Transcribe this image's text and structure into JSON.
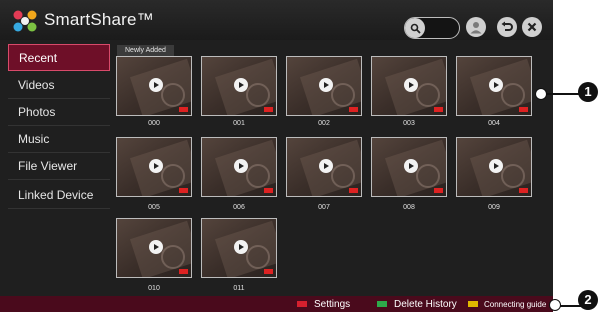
{
  "header": {
    "title": "SmartShare™",
    "icons": {
      "logo": "smartshare-logo",
      "search": "search-icon",
      "user": "user-icon",
      "back": "back-icon",
      "close": "close-icon"
    }
  },
  "sidebar": {
    "items": [
      {
        "label": "Recent",
        "selected": true
      },
      {
        "label": "Videos"
      },
      {
        "label": "Photos"
      },
      {
        "label": "Music"
      },
      {
        "label": "File Viewer"
      },
      {
        "label": "Linked Device"
      }
    ]
  },
  "content": {
    "section_label": "Newly Added",
    "items": [
      {
        "name": "000"
      },
      {
        "name": "001"
      },
      {
        "name": "002"
      },
      {
        "name": "003"
      },
      {
        "name": "004"
      },
      {
        "name": "005"
      },
      {
        "name": "006"
      },
      {
        "name": "007"
      },
      {
        "name": "008"
      },
      {
        "name": "009"
      },
      {
        "name": "010"
      },
      {
        "name": "011"
      }
    ]
  },
  "footer": {
    "settings": {
      "label": "Settings",
      "key_color": "#d6202e"
    },
    "delete_history": {
      "label": "Delete History",
      "key_color": "#2eaa4a"
    },
    "connecting_guide": {
      "label": "Connecting guide",
      "key_color": "#e1b800"
    }
  },
  "callouts": [
    "1",
    "2"
  ],
  "colors": {
    "accent": "#6e0f28",
    "footer_bg": "#4a0a1c",
    "screen_bg": "#1f1f1f"
  }
}
